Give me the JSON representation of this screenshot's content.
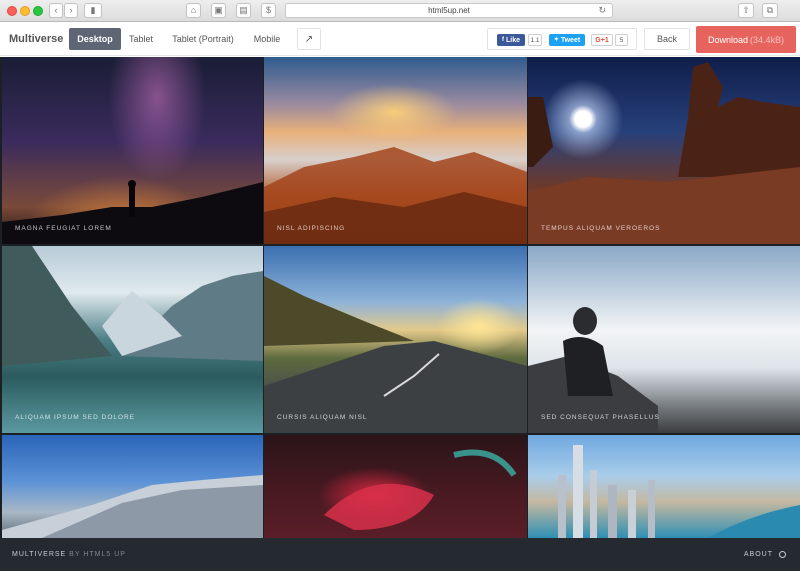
{
  "browser": {
    "address": "html5up.net"
  },
  "toolbar": {
    "brand": "Multiverse",
    "tabs": [
      {
        "label": "Desktop",
        "active": true
      },
      {
        "label": "Tablet",
        "active": false
      },
      {
        "label": "Tablet (Portrait)",
        "active": false
      },
      {
        "label": "Mobile",
        "active": false
      }
    ],
    "social": {
      "like_label": "Like",
      "like_count": "1.1",
      "tweet_label": "Tweet",
      "gplus_label": "G+1",
      "gplus_count": "5"
    },
    "back_label": "Back",
    "download_label": "Download",
    "download_size": "(34.4kB)"
  },
  "gallery": {
    "items": [
      {
        "caption": "Magna feugiat lorem"
      },
      {
        "caption": "Nisl adipiscing"
      },
      {
        "caption": "Tempus aliquam veroeros"
      },
      {
        "caption": "Aliquam ipsum sed dolore"
      },
      {
        "caption": "Cursis aliquam nisl"
      },
      {
        "caption": "Sed consequat phasellus"
      },
      {
        "caption": ""
      },
      {
        "caption": ""
      },
      {
        "caption": ""
      }
    ]
  },
  "footer": {
    "brand": "Multiverse",
    "by": "by HTML5 UP",
    "about": "About"
  },
  "colors": {
    "active_tab": "#5e6676",
    "download": "#e7645e",
    "footer_bg": "#242a30",
    "facebook": "#3b5998",
    "twitter": "#1da1f2",
    "gplus": "#ffffff"
  }
}
